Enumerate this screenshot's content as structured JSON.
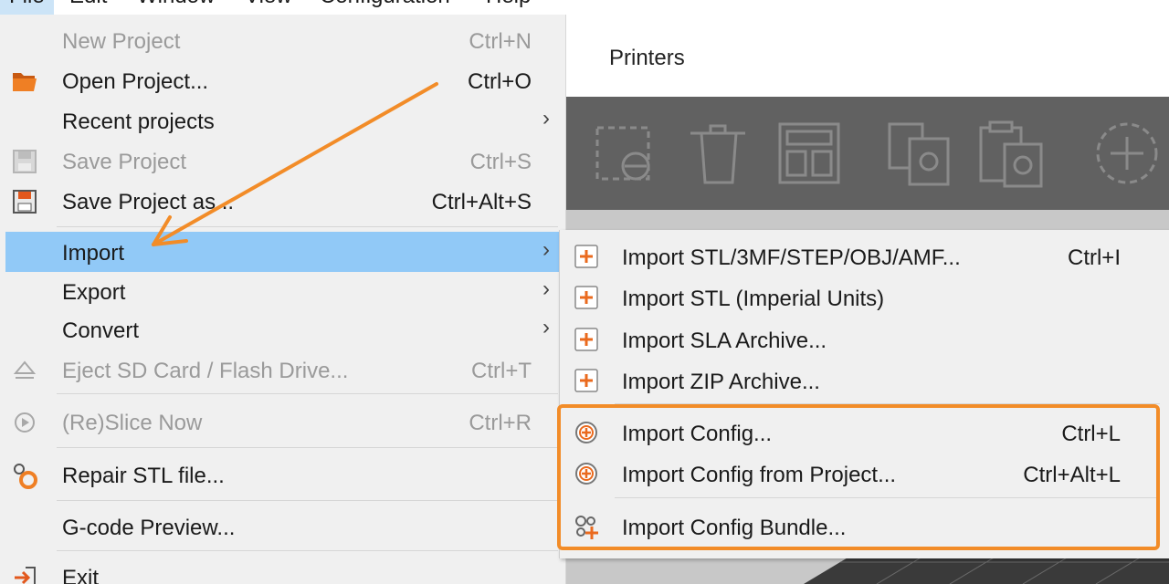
{
  "menubar": {
    "items": [
      "File",
      "Edit",
      "Window",
      "View",
      "Configuration",
      "Help"
    ]
  },
  "app": {
    "printers_tab": "Printers"
  },
  "file_menu": {
    "items": [
      {
        "label": "New Project",
        "shortcut": "Ctrl+N",
        "icon": "none",
        "disabled": true
      },
      {
        "label": "Open Project...",
        "shortcut": "Ctrl+O",
        "icon": "folder-icon",
        "disabled": false
      },
      {
        "label": "Recent projects",
        "shortcut": "",
        "icon": "none",
        "submenu": true
      },
      {
        "label": "Save Project",
        "shortcut": "Ctrl+S",
        "icon": "save-icon",
        "disabled": true
      },
      {
        "label": "Save Project as...",
        "shortcut": "Ctrl+Alt+S",
        "icon": "save-as-icon",
        "disabled": false
      },
      {
        "label": "Import",
        "shortcut": "",
        "icon": "none",
        "submenu": true,
        "highlighted": true
      },
      {
        "label": "Export",
        "shortcut": "",
        "icon": "none",
        "submenu": true
      },
      {
        "label": "Convert",
        "shortcut": "",
        "icon": "none",
        "submenu": true
      },
      {
        "label": "Eject SD Card / Flash Drive...",
        "shortcut": "Ctrl+T",
        "icon": "eject-icon",
        "disabled": true
      },
      {
        "label": "(Re)Slice Now",
        "shortcut": "Ctrl+R",
        "icon": "slice-icon",
        "disabled": true
      },
      {
        "label": "Repair STL file...",
        "shortcut": "",
        "icon": "repair-icon",
        "disabled": false
      },
      {
        "label": "G-code Preview...",
        "shortcut": "",
        "icon": "none",
        "disabled": false
      },
      {
        "label": "Exit",
        "shortcut": "",
        "icon": "exit-icon",
        "disabled": false
      }
    ],
    "submenu_arrow": "›"
  },
  "import_submenu": {
    "items": [
      {
        "label": "Import STL/3MF/STEP/OBJ/AMF...",
        "shortcut": "Ctrl+I",
        "icon": "plus-square-icon"
      },
      {
        "label": "Import STL (Imperial Units)",
        "shortcut": "",
        "icon": "plus-square-icon"
      },
      {
        "label": "Import SLA Archive...",
        "shortcut": "",
        "icon": "plus-square-icon"
      },
      {
        "label": "Import ZIP Archive...",
        "shortcut": "",
        "icon": "plus-square-icon"
      },
      {
        "label": "Import Config...",
        "shortcut": "Ctrl+L",
        "icon": "config-gear-icon"
      },
      {
        "label": "Import Config from Project...",
        "shortcut": "Ctrl+Alt+L",
        "icon": "config-gear-icon"
      },
      {
        "label": "Import Config Bundle...",
        "shortcut": "",
        "icon": "config-bundle-icon"
      }
    ]
  },
  "colors": {
    "accent_orange": "#f28c28",
    "highlight_blue": "#91c9f7",
    "menu_bg": "#f0f0f0",
    "toolbar_dark": "#616161"
  }
}
